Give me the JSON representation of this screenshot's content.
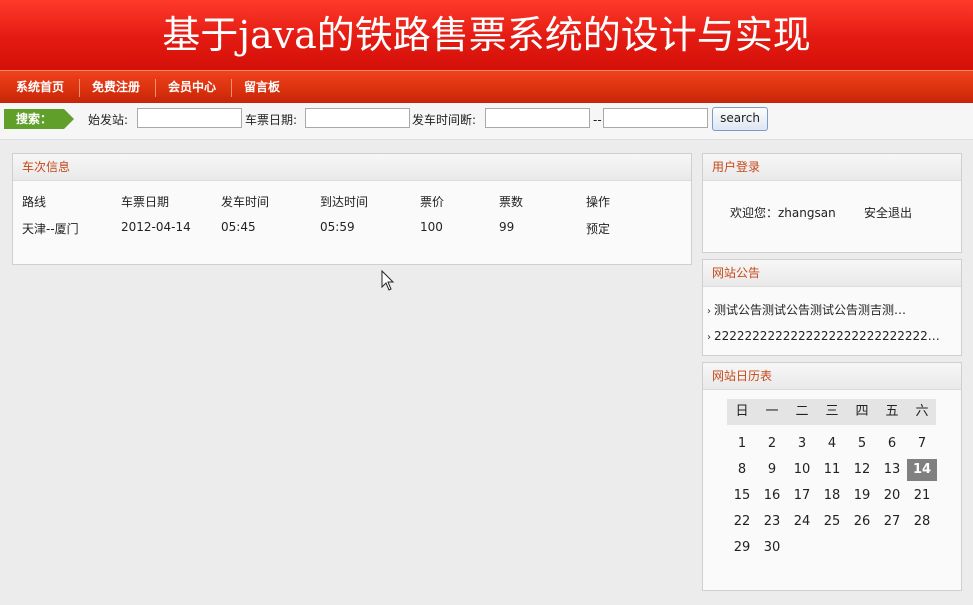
{
  "banner": {
    "title": "基于java的铁路售票系统的设计与实现"
  },
  "nav": {
    "items": [
      "系统首页",
      "免费注册",
      "会员中心",
      "留言板"
    ]
  },
  "search": {
    "tag": "搜索：",
    "start_label": "始发站:",
    "date_label": "车票日期:",
    "time_label": "发车时间断:",
    "range_sep": "--",
    "button": "search",
    "start_value": "",
    "date_value": "",
    "time_from_value": "",
    "time_to_value": ""
  },
  "trains": {
    "title": "车次信息",
    "columns": [
      "路线",
      "车票日期",
      "发车时间",
      "到达时间",
      "票价",
      "票数",
      "操作"
    ],
    "rows": [
      {
        "route": "天津--厦门",
        "date": "2012-04-14",
        "depart": "05:45",
        "arrive": "05:59",
        "price": "100",
        "count": "99",
        "action": "预定"
      }
    ]
  },
  "login": {
    "title": "用户登录",
    "welcome": "欢迎您：zhangsan",
    "logout": "安全退出"
  },
  "notices": {
    "title": "网站公告",
    "items": [
      "测试公告测试公告测试公告测吉测…",
      "2222222222222222222222222222…"
    ]
  },
  "calendar": {
    "title": "网站日历表",
    "weekdays": [
      "日",
      "一",
      "二",
      "三",
      "四",
      "五",
      "六"
    ],
    "weeks": [
      [
        "1",
        "2",
        "3",
        "4",
        "5",
        "6",
        "7"
      ],
      [
        "8",
        "9",
        "10",
        "11",
        "12",
        "13",
        "14"
      ],
      [
        "15",
        "16",
        "17",
        "18",
        "19",
        "20",
        "21"
      ],
      [
        "22",
        "23",
        "24",
        "25",
        "26",
        "27",
        "28"
      ],
      [
        "29",
        "30",
        "",
        "",
        "",
        "",
        ""
      ]
    ],
    "today": "14"
  }
}
